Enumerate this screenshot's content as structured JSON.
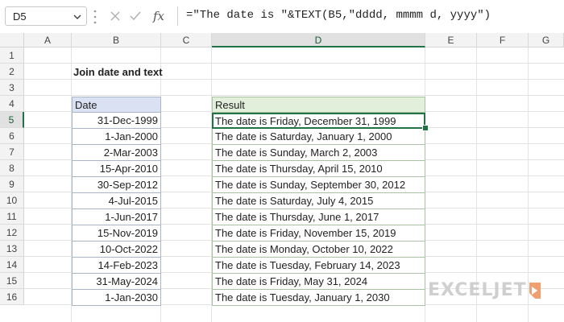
{
  "formula_bar": {
    "name_box": "D5",
    "formula": "=\"The date is \"&TEXT(B5,\"dddd, mmmm d, yyyy\")",
    "fx_label": "fx"
  },
  "columns": [
    "A",
    "B",
    "C",
    "D",
    "E",
    "F",
    "G"
  ],
  "rows": [
    "1",
    "2",
    "3",
    "4",
    "5",
    "6",
    "7",
    "8",
    "9",
    "10",
    "11",
    "12",
    "13",
    "14",
    "15",
    "16"
  ],
  "active_cell": "D5",
  "sheet": {
    "title": "Join date and text",
    "date_header": "Date",
    "result_header": "Result",
    "dates": [
      "31-Dec-1999",
      "1-Jan-2000",
      "2-Mar-2003",
      "15-Apr-2010",
      "30-Sep-2012",
      "4-Jul-2015",
      "1-Jun-2017",
      "15-Nov-2019",
      "10-Oct-2022",
      "14-Feb-2023",
      "31-May-2024",
      "1-Jan-2030"
    ],
    "results": [
      "The date is Friday, December 31, 1999",
      "The date is Saturday, January 1, 2000",
      "The date is Sunday, March 2, 2003",
      "The date is Thursday, April 15, 2010",
      "The date is Sunday, September 30, 2012",
      "The date is Saturday, July 4, 2015",
      "The date is Thursday, June 1, 2017",
      "The date is Friday, November 15, 2019",
      "The date is Monday, October 10, 2022",
      "The date is Tuesday, February 14, 2023",
      "The date is Friday, May 31, 2024",
      "The date is Tuesday, January 1, 2030"
    ]
  },
  "logo": {
    "text": "EXCELJET",
    "color": "#cfcfcf",
    "accent": "#f0a070"
  },
  "colors": {
    "excel_green": "#217346",
    "date_header_bg": "#d9e1f2",
    "result_header_bg": "#e2efda"
  }
}
